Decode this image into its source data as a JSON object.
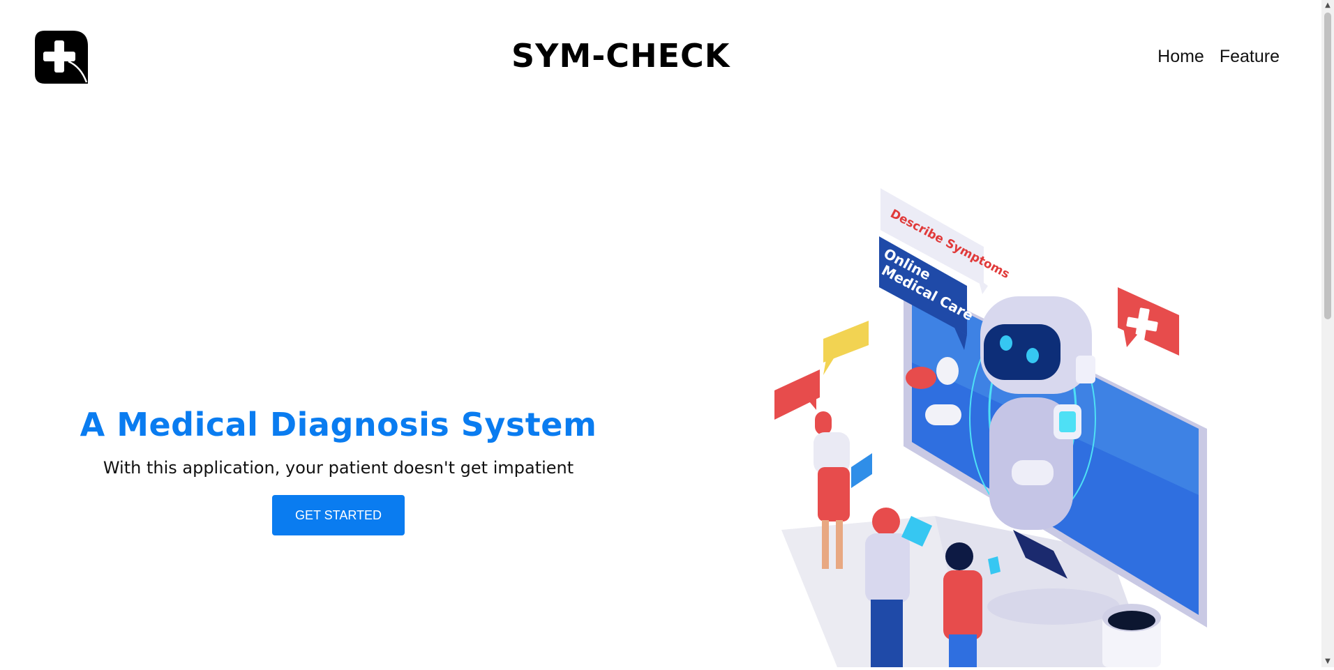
{
  "header": {
    "brand": "SYM-CHECK",
    "logo_icon": "medical-cross-leaf-icon",
    "nav": [
      {
        "label": "Home"
      },
      {
        "label": "Feature"
      }
    ]
  },
  "hero": {
    "title": "A Medical Diagnosis System",
    "subtitle": "With this application, your patient doesn't get impatient",
    "cta_label": "GET STARTED",
    "accent_color": "#0a7cf0"
  },
  "illustration": {
    "bubble_symptoms": "Describe Symptoms",
    "sign_line1": "Online",
    "sign_line2": "Medical Care"
  }
}
